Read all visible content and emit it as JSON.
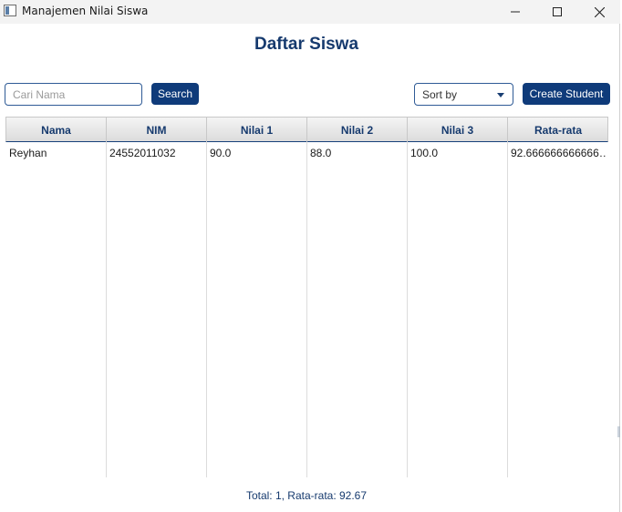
{
  "window": {
    "title": "Manajemen Nilai Siswa",
    "minimize_glyph": "—",
    "maximize_glyph": "☐",
    "close_glyph": "✕"
  },
  "page": {
    "title": "Daftar Siswa"
  },
  "toolbar": {
    "search_placeholder": "Cari Nama",
    "search_value": "",
    "search_label": "Search",
    "sort_label": "Sort by",
    "create_label": "Create Student"
  },
  "table": {
    "columns": [
      "Nama",
      "NIM",
      "Nilai 1",
      "Nilai 2",
      "Nilai 3",
      "Rata-rata"
    ],
    "rows": [
      [
        "Reyhan",
        "24552011032",
        "90.0",
        "88.0",
        "100.0",
        "92.666666666666…"
      ]
    ]
  },
  "footer": {
    "summary": "Total: 1, Rata-rata: 92.67"
  },
  "colors": {
    "accent": "#0f3b7a",
    "heading": "#163a6e"
  }
}
